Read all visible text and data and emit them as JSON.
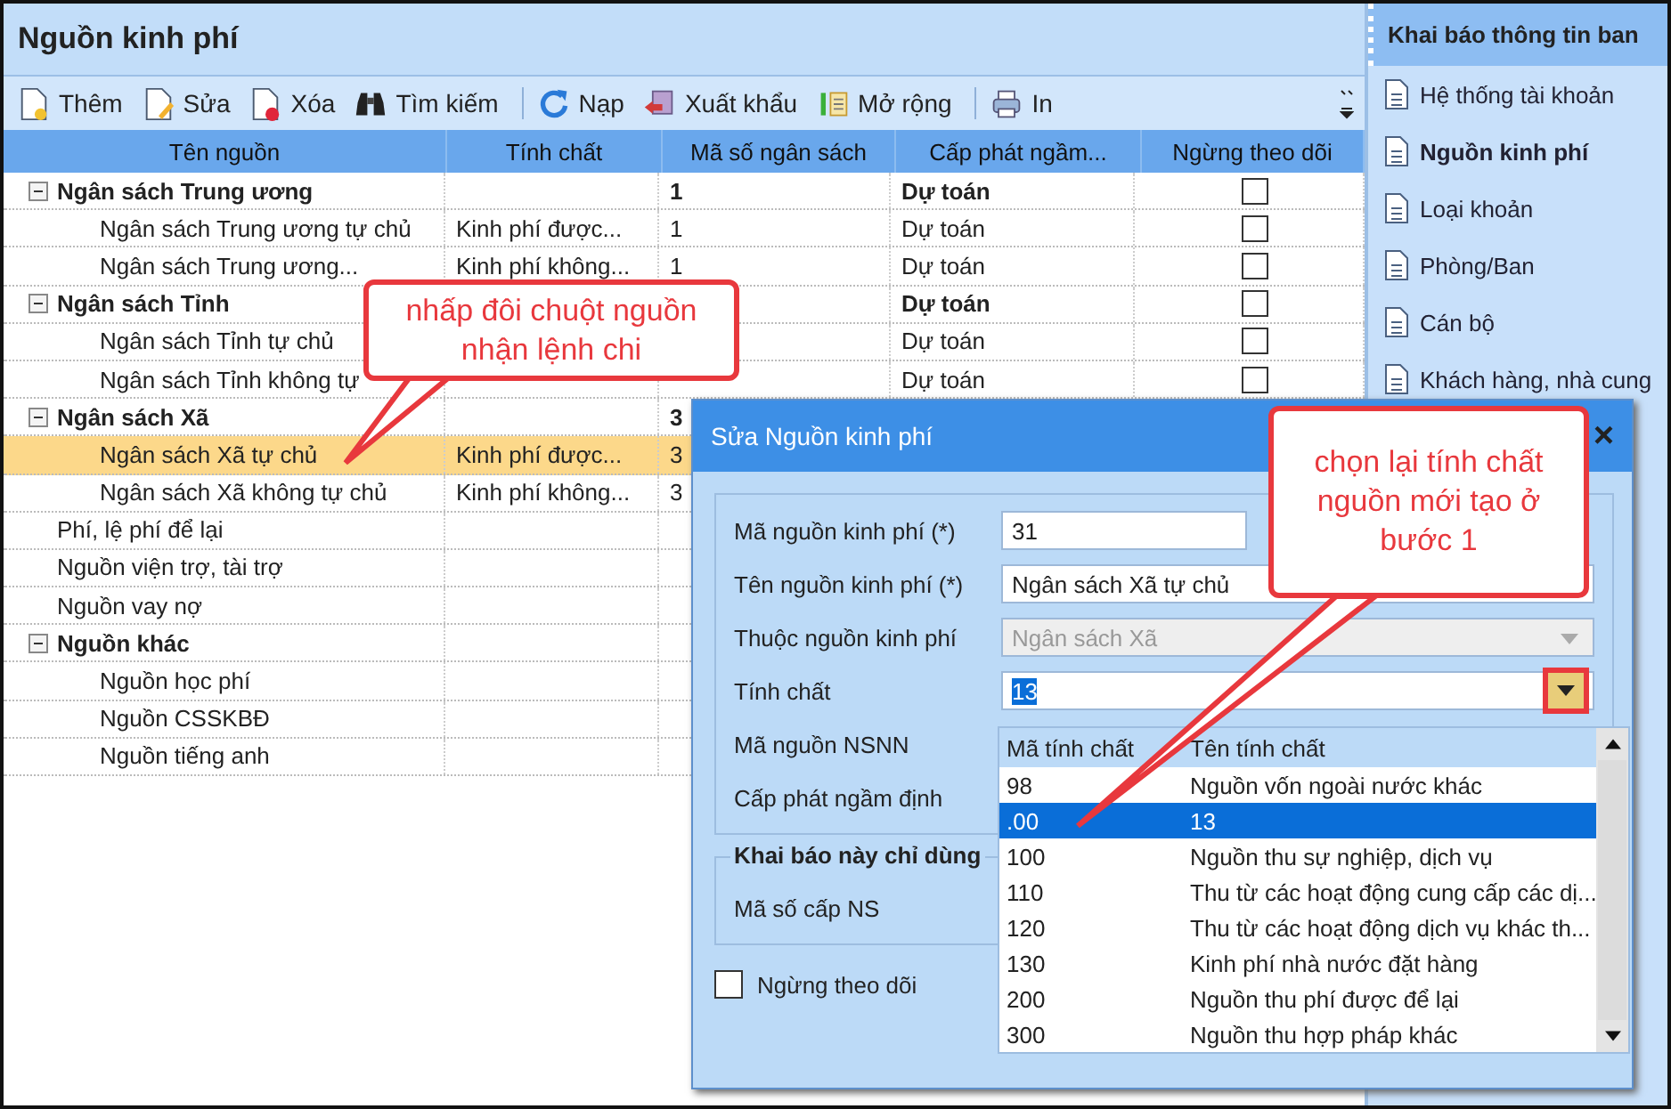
{
  "main": {
    "title": "Nguồn kinh phí",
    "toolbar": [
      {
        "kind": "button",
        "label": "Thêm"
      },
      {
        "kind": "button",
        "label": "Sửa"
      },
      {
        "kind": "button",
        "label": "Xóa"
      },
      {
        "kind": "button",
        "label": "Tìm kiếm"
      },
      {
        "kind": "separator"
      },
      {
        "kind": "button",
        "label": "Nạp"
      },
      {
        "kind": "button",
        "label": "Xuất khẩu"
      },
      {
        "kind": "button",
        "label": "Mở rộng"
      },
      {
        "kind": "separator"
      },
      {
        "kind": "button",
        "label": "In"
      }
    ],
    "columns": [
      "Tên nguồn",
      "Tính chất",
      "Mã số ngân sách",
      "Cấp phát ngầm...",
      "Ngừng theo dõi"
    ],
    "rows": [
      {
        "name": "Ngân sách Trung ương",
        "expanded": true,
        "selected": false,
        "ma_so": "1",
        "cap_phat": "Dự toán",
        "stopped": false,
        "children": [
          {
            "name": "Ngân sách Trung ương tự chủ",
            "selected": false,
            "tinh_chat": "Kinh phí được...",
            "ma_so": "1",
            "cap_phat": "Dự toán",
            "stopped": false
          },
          {
            "name": "Ngân sách Trung ương...",
            "selected": false,
            "tinh_chat": "Kinh phí không...",
            "ma_so": "1",
            "cap_phat": "Dự toán",
            "stopped": false
          }
        ]
      },
      {
        "name": "Ngân sách Tỉnh",
        "expanded": true,
        "selected": false,
        "cap_phat": "Dự toán",
        "stopped": false,
        "children": [
          {
            "name": "Ngân sách Tỉnh tự chủ",
            "selected": false,
            "cap_phat": "Dự toán",
            "stopped": false
          },
          {
            "name": "Ngân sách Tỉnh không tự",
            "selected": false,
            "cap_phat": "Dự toán",
            "stopped": false
          }
        ]
      },
      {
        "name": "Ngân sách Xã",
        "expanded": true,
        "selected": false,
        "ma_so": "3",
        "children": [
          {
            "name": "Ngân sách Xã tự chủ",
            "selected": true,
            "tinh_chat": "Kinh phí được...",
            "ma_so": "3"
          },
          {
            "name": "Ngân sách Xã không tự chủ",
            "selected": false,
            "tinh_chat": "Kinh phí không...",
            "ma_so": "3"
          }
        ]
      },
      {
        "name": "Phí, lệ phí để lại",
        "selected": false
      },
      {
        "name": "Nguồn viện trợ, tài trợ",
        "selected": false
      },
      {
        "name": "Nguồn vay nợ",
        "selected": false
      },
      {
        "name": "Nguồn khác",
        "expanded": true,
        "selected": false,
        "children": [
          {
            "name": "Nguồn học phí",
            "selected": false
          },
          {
            "name": "Nguồn CSSKBĐ",
            "selected": false
          },
          {
            "name": "Nguồn tiếng anh",
            "selected": false
          }
        ]
      }
    ]
  },
  "sidebar": {
    "title": "Khai báo thông tin ban",
    "items": [
      {
        "label": "Hệ thống tài khoản",
        "selected": false
      },
      {
        "label": "Nguồn kinh phí",
        "selected": true
      },
      {
        "label": "Loại khoản",
        "selected": false
      },
      {
        "label": "Phòng/Ban",
        "selected": false
      },
      {
        "label": "Cán bộ",
        "selected": false
      },
      {
        "label": "Khách hàng, nhà cung",
        "selected": false
      }
    ]
  },
  "dialog": {
    "title": "Sửa Nguồn kinh phí",
    "close": "×",
    "fields": [
      {
        "kind": "input",
        "label": "Mã nguồn kinh phí (*)",
        "value": "31"
      },
      {
        "kind": "input",
        "label": "Tên nguồn kinh phí (*)",
        "value": "Ngân sách Xã tự chủ"
      },
      {
        "kind": "disabled-combo",
        "label": "Thuộc nguồn kinh phí",
        "value": "Ngân sách Xã"
      },
      {
        "kind": "open-combo",
        "label": "Tính chất",
        "value": "13"
      },
      {
        "kind": "label",
        "label": "Mã nguồn NSNN"
      },
      {
        "kind": "label",
        "label": "Cấp phát ngầm định"
      }
    ],
    "group_title": "Khai báo này chỉ dùng",
    "group_fields": [
      {
        "kind": "label",
        "label": "Mã số cấp NS"
      }
    ],
    "stop_tracking": {
      "label": "Ngừng theo dõi",
      "checked": false
    }
  },
  "dropdown": {
    "columns": [
      "Mã tính chất",
      "Tên tính chất"
    ],
    "rows": [
      {
        "code": "98",
        "name": "Nguồn vốn ngoài nước khác",
        "selected": false
      },
      {
        "code": ".00",
        "name": "13",
        "selected": true
      },
      {
        "code": "100",
        "name": "Nguồn thu sự nghiệp, dịch vụ",
        "selected": false
      },
      {
        "code": "110",
        "name": "Thu từ các hoạt động cung cấp các dị...",
        "selected": false
      },
      {
        "code": "120",
        "name": "Thu từ các hoạt động dịch vụ khác th...",
        "selected": false
      },
      {
        "code": "130",
        "name": "Kinh phí nhà nước đặt hàng",
        "selected": false
      },
      {
        "code": "200",
        "name": "Nguồn thu phí được để lại",
        "selected": false
      },
      {
        "code": "300",
        "name": "Nguồn thu hợp pháp khác",
        "selected": false
      }
    ]
  },
  "callouts": [
    "nhấp đôi chuột nguồn nhận lệnh chi",
    "chọn lại tính chất nguồn mới tạo ở bước 1"
  ]
}
